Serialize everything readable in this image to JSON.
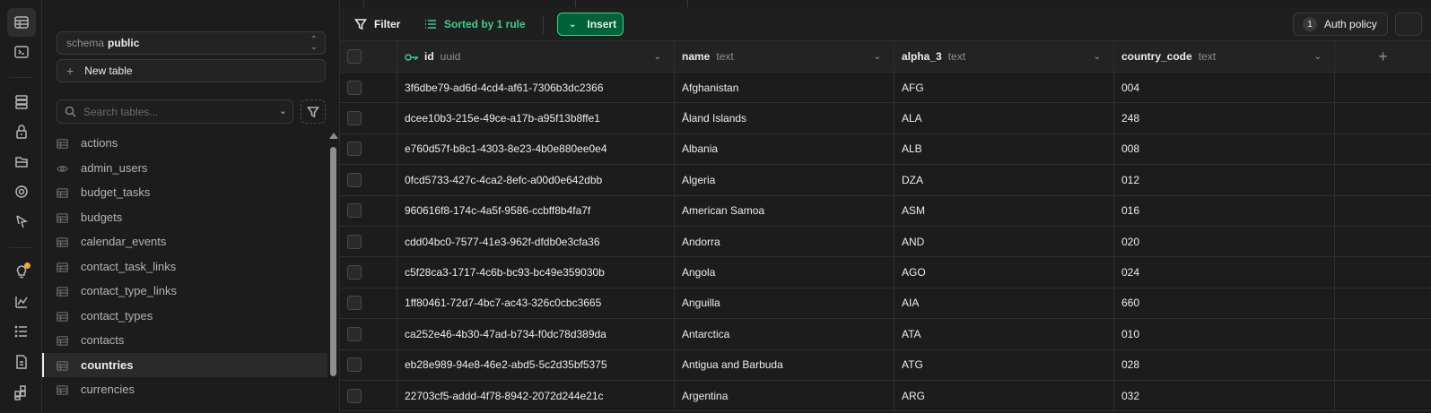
{
  "rail": {
    "icons": [
      "table-editor-icon",
      "sql-editor-icon",
      "database-icon",
      "auth-icon",
      "storage-icon",
      "realtime-icon",
      "edge-functions-icon",
      "advisors-icon",
      "reports-icon",
      "logs-icon",
      "api-docs-icon",
      "integrations-icon"
    ]
  },
  "sidebar": {
    "schema_label": "schema",
    "schema_value": "public",
    "new_table_label": "New table",
    "search_placeholder": "Search tables...",
    "tables": [
      {
        "name": "actions",
        "icon": "table-icon"
      },
      {
        "name": "admin_users",
        "icon": "view-icon"
      },
      {
        "name": "budget_tasks",
        "icon": "table-icon"
      },
      {
        "name": "budgets",
        "icon": "table-icon"
      },
      {
        "name": "calendar_events",
        "icon": "table-icon"
      },
      {
        "name": "contact_task_links",
        "icon": "table-icon"
      },
      {
        "name": "contact_type_links",
        "icon": "table-icon"
      },
      {
        "name": "contact_types",
        "icon": "table-icon"
      },
      {
        "name": "contacts",
        "icon": "table-icon"
      },
      {
        "name": "countries",
        "icon": "table-icon",
        "active": true
      },
      {
        "name": "currencies",
        "icon": "table-icon"
      }
    ]
  },
  "toolbar": {
    "filter_label": "Filter",
    "sort_label": "Sorted by 1 rule",
    "insert_label": "Insert",
    "auth_policy_count": "1",
    "auth_policy_label": "Auth policy"
  },
  "grid": {
    "columns": [
      {
        "name": "id",
        "type": "uuid",
        "primary_key": true
      },
      {
        "name": "name",
        "type": "text"
      },
      {
        "name": "alpha_3",
        "type": "text"
      },
      {
        "name": "country_code",
        "type": "text"
      }
    ],
    "rows": [
      [
        "3f6dbe79-ad6d-4cd4-af61-7306b3dc2366",
        "Afghanistan",
        "AFG",
        "004"
      ],
      [
        "dcee10b3-215e-49ce-a17b-a95f13b8ffe1",
        "Åland Islands",
        "ALA",
        "248"
      ],
      [
        "e760d57f-b8c1-4303-8e23-4b0e880ee0e4",
        "Albania",
        "ALB",
        "008"
      ],
      [
        "0fcd5733-427c-4ca2-8efc-a00d0e642dbb",
        "Algeria",
        "DZA",
        "012"
      ],
      [
        "960616f8-174c-4a5f-9586-ccbff8b4fa7f",
        "American Samoa",
        "ASM",
        "016"
      ],
      [
        "cdd04bc0-7577-41e3-962f-dfdb0e3cfa36",
        "Andorra",
        "AND",
        "020"
      ],
      [
        "c5f28ca3-1717-4c6b-bc93-bc49e359030b",
        "Angola",
        "AGO",
        "024"
      ],
      [
        "1ff80461-72d7-4bc7-ac43-326c0cbc3665",
        "Anguilla",
        "AIA",
        "660"
      ],
      [
        "ca252e46-4b30-47ad-b734-f0dc78d389da",
        "Antarctica",
        "ATA",
        "010"
      ],
      [
        "eb28e989-94e8-46e2-abd5-5c2d35bf5375",
        "Antigua and Barbuda",
        "ATG",
        "028"
      ],
      [
        "22703cf5-addd-4f78-8942-2072d244e21c",
        "Argentina",
        "ARG",
        "032"
      ]
    ]
  },
  "colors": {
    "accent_green": "#3ecf8e",
    "insert_bg": "#006239",
    "notification_dot": "#f5a623"
  }
}
